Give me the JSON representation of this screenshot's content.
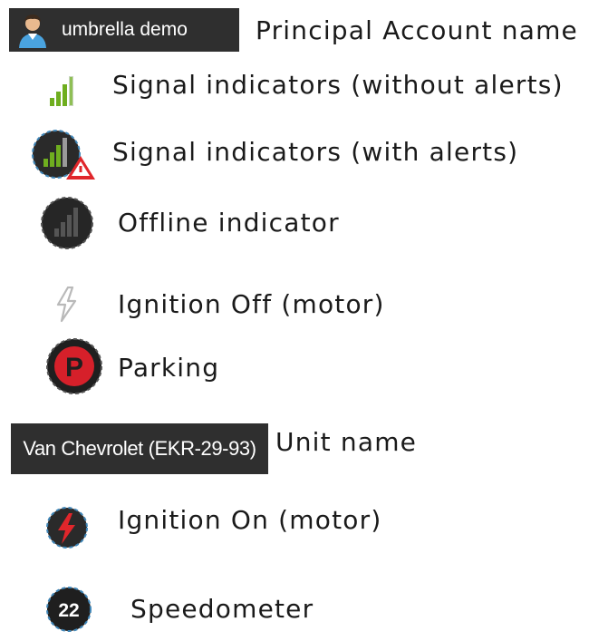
{
  "legend": {
    "account": {
      "badge_text": "umbrella demo",
      "label": "Principal Account name",
      "icon": "user-avatar-icon"
    },
    "signal_no_alerts": {
      "label": "Signal indicators (without alerts)",
      "icon": "signal-bars-icon"
    },
    "signal_with_alerts": {
      "label": "Signal indicators (with alerts)",
      "icon": "signal-bars-alert-icon"
    },
    "offline": {
      "label": "Offline indicator",
      "icon": "offline-signal-icon"
    },
    "ignition_off": {
      "label": "Ignition Off (motor)",
      "icon": "lightning-off-icon"
    },
    "parking": {
      "label": "Parking",
      "icon_letter": "P",
      "icon": "parking-icon"
    },
    "unit": {
      "badge_text": "Van Chevrolet (EKR-29-93)",
      "label": "Unit name"
    },
    "ignition_on": {
      "label": "Ignition On (motor)",
      "icon": "lightning-on-icon"
    },
    "speedometer": {
      "value": "22",
      "label": "Speedometer",
      "icon": "speedometer-icon"
    }
  },
  "colors": {
    "badge_background": "#2f2f2f",
    "signal_green": "#6fae1f",
    "alert_red": "#e0262b",
    "parking_red": "#d6202a",
    "icon_dark": "#2a2a2a",
    "ring_blue": "#3f86b8"
  }
}
